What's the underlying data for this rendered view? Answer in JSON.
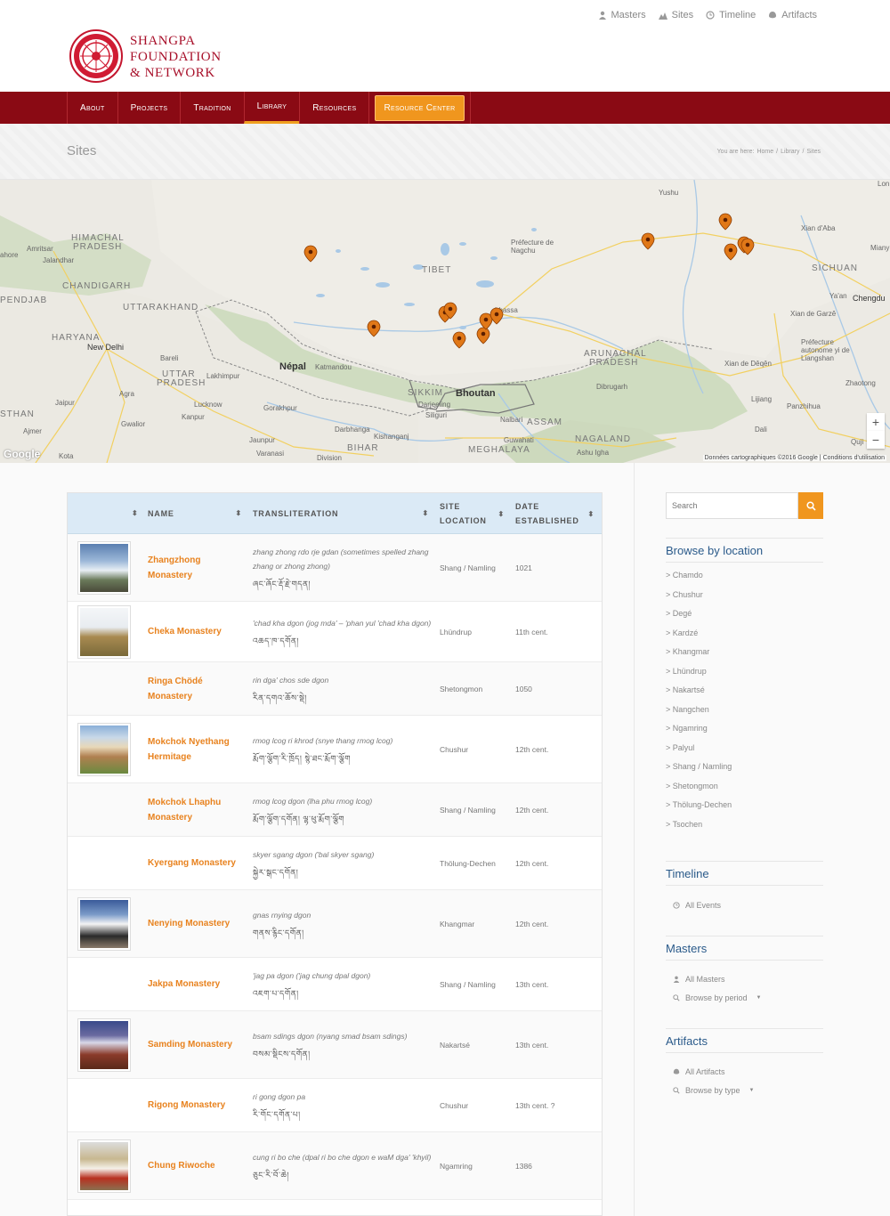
{
  "brand": {
    "line1": "SHANGPA",
    "line2": "FOUNDATION",
    "line3": "& NETWORK"
  },
  "toplinks": [
    {
      "label": "Masters",
      "icon": "user-icon"
    },
    {
      "label": "Sites",
      "icon": "sites-icon"
    },
    {
      "label": "Timeline",
      "icon": "clock-icon"
    },
    {
      "label": "Artifacts",
      "icon": "artifact-icon"
    }
  ],
  "nav": [
    "About",
    "Projects",
    "Tradition",
    "Library",
    "Resources"
  ],
  "nav_cta": "Resource Center",
  "page": {
    "title": "Sites",
    "crumb_prefix": "You are here:",
    "crumbs": [
      "Home",
      "Library",
      "Sites"
    ],
    "crumb_sep": "/"
  },
  "map": {
    "labels": {
      "tibet": "TIBET",
      "nepal": "Népal",
      "bhoutan": "Bhoutan",
      "himachal": "HIMACHAL",
      "pradesh1": "PRADESH",
      "chandigarh": "CHANDIGARH",
      "uttarakhand": "UTTARAKHAND",
      "pendjab": "PENDJAB",
      "haryana": "HARYANA",
      "newdelhi": "New Delhi",
      "uttar": "UTTAR",
      "pradesh2": "PRADESH",
      "sikkim": "SIKKIM",
      "assam": "ASSAM",
      "arunachal": "ARUNACHAL",
      "pradesh3": "PRADESH",
      "nagaland": "NAGALAND",
      "meghalaya": "MEGHALAYA",
      "bihar": "BIHAR",
      "sichuan": "SICHUAN",
      "kathmandu": "Katmandou",
      "lhassa": "Lhassa",
      "chengdu": "Chengdu",
      "amritsar": "Amritsar",
      "jalandhar": "Jalandhar",
      "lahore": "ahore",
      "bareli": "Bareli",
      "lakhimpur": "Lakhimpur",
      "agra": "Agra",
      "lucknow": "Lucknow",
      "kanpur": "Kanpur",
      "gorakhpur": "Gorakhpur",
      "jaunpur": "Jaunpur",
      "varanasi": "Varanasi",
      "jaipur": "Jaipur",
      "gwalior": "Gwalior",
      "ajmer": "Ajmer",
      "kota": "Kota",
      "darbhanga": "Darbhanga",
      "kishanganj": "Kishanganj",
      "darjeeling": "Darjeeling",
      "siliguri": "Siliguri",
      "guwahati": "Guwahati",
      "nalbari": "Nalbari",
      "dibrugarh": "Dibrugarh",
      "ashuigha": "Ashu Igha",
      "nagchu": "Préfecture de Nagchu",
      "yushu": "Yushu",
      "abadian": "Xian d'Aba",
      "garze": "Xian de Garzê",
      "yaan": "Ya'an",
      "liangshan": "Préfecture autonome yi de Liangshan",
      "degen": "Xian de Dêqên",
      "lijiang": "Lijiang",
      "dali": "Dali",
      "panzhihua": "Panzhihua",
      "zhaotong": "Zhaotong",
      "qujing": "Quji",
      "stan": "STHAN",
      "miany": "Miany",
      "division": "Division",
      "lon": "Lon"
    },
    "google": "Google",
    "attribution": "Données cartographiques ©2016 Google | Conditions d'utilisation",
    "zoom_in": "+",
    "zoom_out": "−",
    "markers": 17
  },
  "table": {
    "headers": [
      "NAME",
      "TRANSLITERATION",
      "SITE LOCATION",
      "DATE ESTABLISHED"
    ],
    "header_site": [
      "SITE",
      "LOCATION"
    ],
    "header_date": [
      "DATE",
      "ESTABLISHED"
    ],
    "rows": [
      {
        "name": "Zhangzhong Monastery",
        "trans": "zhang zhong rdo rje gdan (sometimes spelled zhang zhang or zhong zhong)",
        "tib": "ཞང་ཞོང་རྡོ་རྗེ་གདན།",
        "loc": "Shang / Namling",
        "date": "1021",
        "img": "snow"
      },
      {
        "name": "Cheka Monastery",
        "trans": "'chad kha dgon (jog mda' – 'phan yul 'chad kha dgon)",
        "tib": "འཆད་ཁ་དགོན།",
        "loc": "Lhündrup",
        "date": "11th cent.",
        "img": "hill"
      },
      {
        "name": "Ringa Chödé Monastery",
        "trans": "rin dga' chos sde dgon",
        "tib": "རིན་དགའ་ཆོས་སྡེ།",
        "loc": "Shetongmon",
        "date": "1050",
        "img": ""
      },
      {
        "name": "Mokchok Nyethang Hermitage",
        "trans": "rmog lcog ri khrod (snye thang rmog lcog)",
        "tib": "རྨོག་ལྕོག་རི་ཁྲོད། སྙེ་ཐང་རྨོག་ལྕོག",
        "loc": "Chushur",
        "date": "12th cent.",
        "img": "build"
      },
      {
        "name": "Mokchok Lhaphu Monastery",
        "trans": "rmog lcog dgon (lha phu rmog lcog)",
        "tib": "རྨོག་ལྕོག་དགོན། ལྷ་ཕུ་རྨོག་ལྕོག",
        "loc": "Shang / Namling",
        "date": "12th cent.",
        "img": ""
      },
      {
        "name": "Kyergang Monastery",
        "trans": "skyer sgang dgon ('bal skyer sgang)",
        "tib": "སྐྱེར་སྒང་དགོན།",
        "loc": "Thölung-Dechen",
        "date": "12th cent.",
        "img": ""
      },
      {
        "name": "Nenying Monastery",
        "trans": "gnas rnying dgon",
        "tib": "གནས་རྙིང་དགོན།",
        "loc": "Khangmar",
        "date": "12th cent.",
        "img": "white"
      },
      {
        "name": "Jakpa Monastery",
        "trans": "'jag pa dgon ('jag chung dpal dgon)",
        "tib": "འཇག་པ་དགོན།",
        "loc": "Shang / Namling",
        "date": "13th cent.",
        "img": ""
      },
      {
        "name": "Samding Monastery",
        "trans": "bsam sdings dgon (nyang smad bsam sdings)",
        "tib": "བསམ་སྡིངས་དགོན།",
        "loc": "Nakartsé",
        "date": "13th cent.",
        "img": "mount"
      },
      {
        "name": "Rigong Monastery",
        "trans": "ri gong dgon pa",
        "tib": "རི་གོང་དགོན་པ།",
        "loc": "Chushur",
        "date": "13th cent. ?",
        "img": ""
      },
      {
        "name": "Chung Riwoche",
        "trans": "cung ri bo che (dpal ri bo che dgon e waM dga' 'khyil)",
        "tib": "ཅུང་རི་བོ་ཆེ།",
        "loc": "Ngamring",
        "date": "1386",
        "img": "stupa"
      }
    ]
  },
  "sidebar": {
    "search_placeholder": "Search",
    "browse_title": "Browse by location",
    "locations": [
      "> Chamdo",
      "> Chushur",
      "> Degé",
      "> Kardzé",
      "> Khangmar",
      "> Lhündrup",
      "> Nakartsé",
      "> Nangchen",
      "> Ngamring",
      "> Palyul",
      "> Shang / Namling",
      "> Shetongmon",
      "> Thölung-Dechen",
      "> Tsochen"
    ],
    "timeline_title": "Timeline",
    "timeline_all": "All Events",
    "masters_title": "Masters",
    "masters_all": "All Masters",
    "masters_period": "Browse by period",
    "artifacts_title": "Artifacts",
    "artifacts_all": "All Artifacts",
    "artifacts_type": "Browse by type"
  },
  "colors": {
    "brand_red": "#a8102a",
    "nav_red": "#8a0a14",
    "accent_orange": "#f0961e",
    "link_blue": "#2a5a8a"
  }
}
